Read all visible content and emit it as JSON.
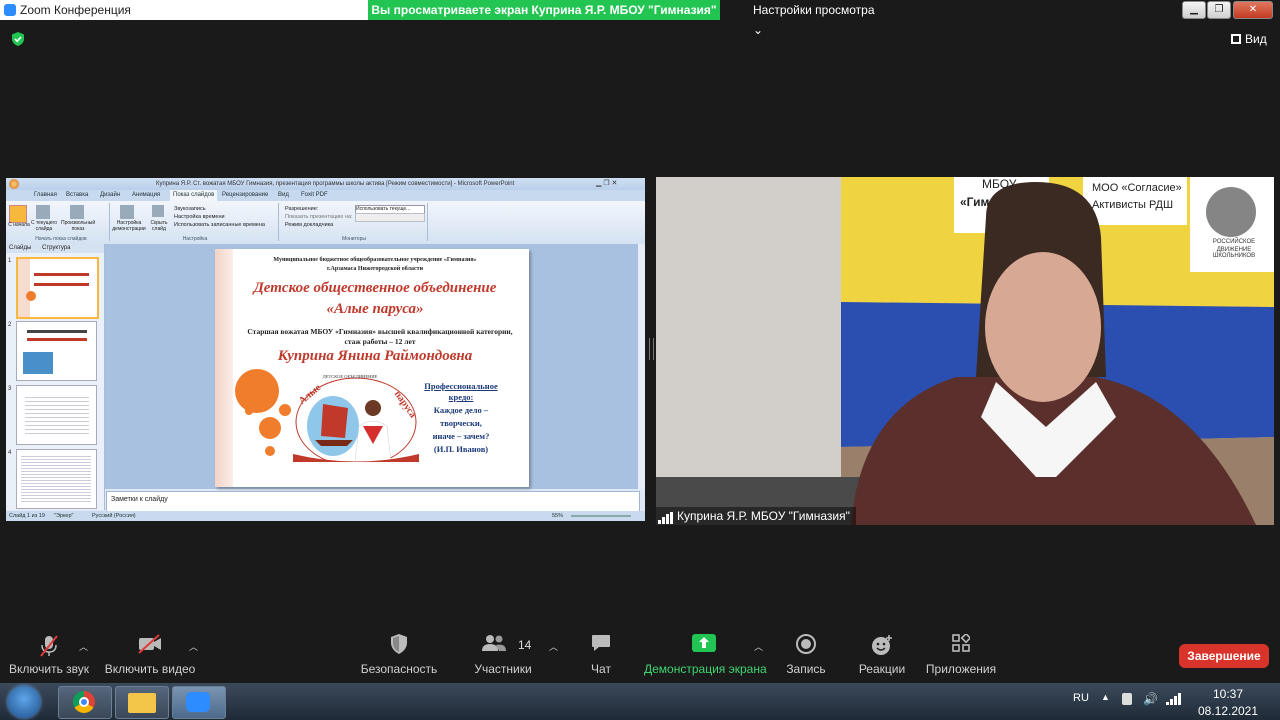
{
  "window": {
    "app_title": "Zoom Конференция"
  },
  "share_banner": "Вы просматриваете экран Куприна Я.Р. МБОУ \"Гимназия\"",
  "view_settings": "Настройки просмотра",
  "view_button": "Вид",
  "ppt": {
    "title": "Куприна Я.Р. Ст. вожатая МБОУ Гимназия, презентация программы школы актива [Режим совместимости] - Microsoft PowerPoint",
    "tabs": [
      "Главная",
      "Вставка",
      "Дизайн",
      "Анимация",
      "Показ слайдов",
      "Рецензирование",
      "Вид",
      "Foxit PDF"
    ],
    "ribbon": {
      "from_start": "С начала",
      "from_current": "С текущего слайда",
      "custom_show": "Произвольный показ",
      "group_start": "Начать показ слайдов",
      "setup": "Настройка демонстрации",
      "hide": "Скрыть слайд",
      "record_narration": "Звукозапись",
      "rehearse": "Настройка времени",
      "use_timings": "Использовать записанные времена",
      "group_setup": "Настройка",
      "resolution": "Разрешение:",
      "resolution_value": "Использовать текуще...",
      "show_on": "Показать презентацию на:",
      "presenter_view": "Режим докладчика",
      "group_monitors": "Мониторы"
    },
    "left_tabs": [
      "Слайды",
      "Структура"
    ],
    "thumb_numbers": [
      "1",
      "2",
      "3",
      "4"
    ],
    "notes_placeholder": "Заметки к слайду",
    "status": {
      "slide": "Слайд 1 из 19",
      "theme": "\"Эркер\"",
      "lang": "Русский (Россия)",
      "zoom": "55%"
    }
  },
  "slide": {
    "org": "Муниципальное бюджетное общеобразовательное учреждение «Гимназия»",
    "city": "г.Арзамаса Нижегородской области",
    "title_line1": "Детское общественное объединение",
    "title_line2": "«Алые паруса»",
    "position_line1": "Старшая вожатая МБОУ «Гимназия» высшей квалификационной категории,",
    "position_line2": "стаж работы – 12 лет",
    "name": "Куприна Янина Раймондовна",
    "credo_title1": "Профессиональное",
    "credo_title2": "кредо:",
    "credo_lines": [
      "Каждое дело –",
      "творчески,",
      "иначе – зачем?",
      "(И.П. Иванов)"
    ],
    "logo_top": "ДЕТСКОЕ ОБЪЕДИНЕНИЕ",
    "logo_left": "Алые",
    "logo_right": "паруса"
  },
  "video": {
    "participant_label": "Куприна Я.Р. МБОУ \"Гимназия\"",
    "sign1": "МБОУ",
    "sign1b": "«Гим",
    "sign2a": "МОО «Согласие»",
    "sign2b": "Активисты РДШ",
    "sign3a": "РОССИЙСКОЕ",
    "sign3b": "ДВИЖЕНИЕ ШКОЛЬНИКОВ"
  },
  "toolbar": {
    "unmute": "Включить звук",
    "start_video": "Включить видео",
    "security": "Безопасность",
    "participants": "Участники",
    "participants_count": "14",
    "chat": "Чат",
    "share": "Демонстрация экрана",
    "record": "Запись",
    "reactions": "Реакции",
    "apps": "Приложения",
    "end": "Завершение"
  },
  "taskbar": {
    "lang": "RU",
    "time": "10:37",
    "date": "08.12.2021"
  },
  "colors": {
    "share_green": "#23c552",
    "end_red": "#d9342b",
    "slide_red": "#c0392b",
    "orange": "#f07d2b"
  }
}
